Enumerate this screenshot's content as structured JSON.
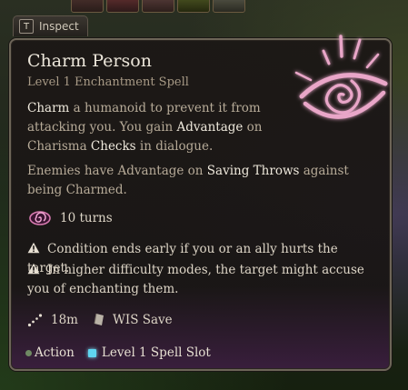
{
  "inspect_tab": {
    "key": "T",
    "label": "Inspect"
  },
  "spell": {
    "name": "Charm Person",
    "level_school": "Level 1 Enchantment Spell",
    "description": {
      "kw_charm": "Charm",
      "p1": " a humanoid to prevent it from attacking you. You gain ",
      "kw_advantage": "Advantage",
      "p2": " on Charisma ",
      "kw_checks": "Checks",
      "p3": " in dialogue."
    },
    "enemy_note": {
      "p1": "Enemies have Advantage on ",
      "kw_saving_throws": "Saving Throws",
      "p2": " against being Charmed."
    },
    "duration": "10 turns",
    "warnings": [
      "Condition ends early if you or an ally hurts the target.",
      "In higher difficulty modes, the target might accuse you of enchanting them."
    ],
    "range": "18m",
    "save": "WIS Save",
    "cost": {
      "action": "Action",
      "slot": "Level 1 Spell Slot"
    }
  },
  "colors": {
    "accent_pink": "#e9a6c8",
    "spell_slot": "#5fd6f0",
    "action_dot": "#6f8a63",
    "highlight_text": "#efe9dc",
    "body_text": "#b7ab98"
  }
}
